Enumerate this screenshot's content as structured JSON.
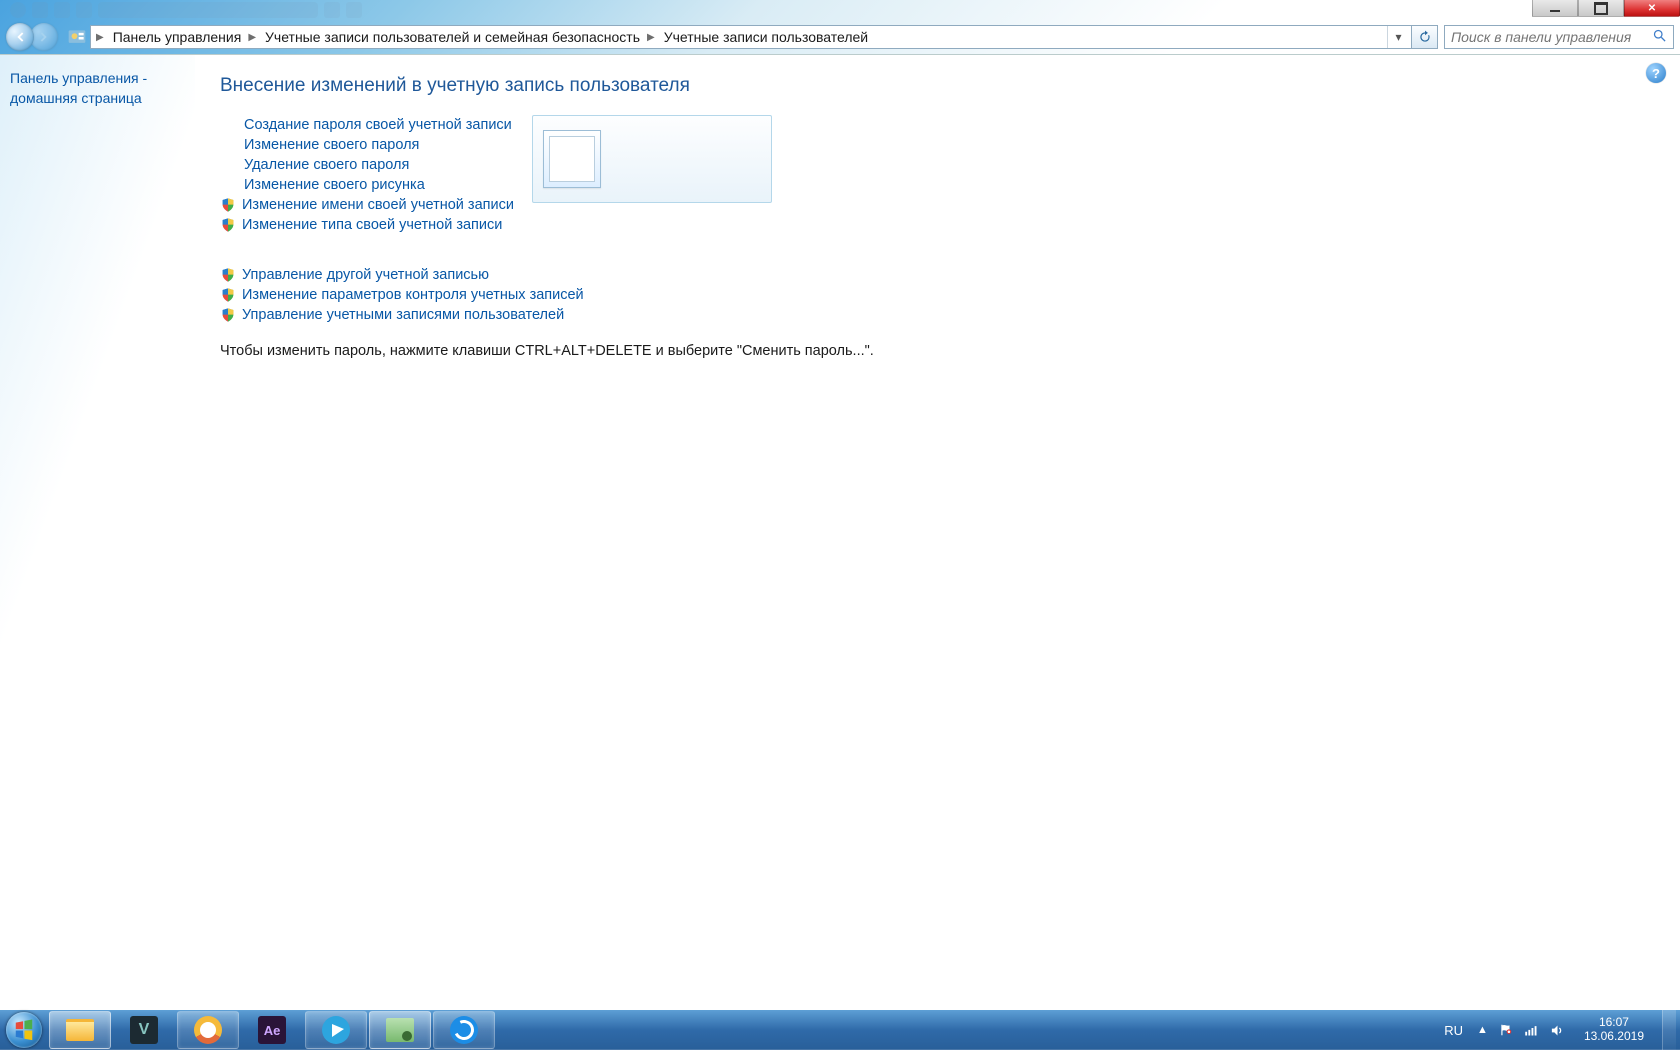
{
  "breadcrumb": {
    "root": "Панель управления",
    "level1": "Учетные записи пользователей и семейная безопасность",
    "level2": "Учетные записи пользователей"
  },
  "search": {
    "placeholder": "Поиск в панели управления"
  },
  "left": {
    "home_line1": "Панель управления -",
    "home_line2": "домашняя страница"
  },
  "main": {
    "heading": "Внесение изменений в учетную запись пользователя",
    "tasks1": [
      "Создание пароля своей учетной записи",
      "Изменение своего пароля",
      "Удаление своего пароля",
      "Изменение своего рисунка",
      "Изменение имени своей учетной записи",
      "Изменение типа своей учетной записи"
    ],
    "tasks1_shield_from_index": 4,
    "tasks2": [
      "Управление другой учетной записью",
      "Изменение параметров контроля учетных записей",
      "Управление учетными записями пользователей"
    ],
    "hint": "Чтобы изменить пароль, нажмите клавиши CTRL+ALT+DELETE и выберите \"Сменить пароль...\"."
  },
  "tray": {
    "lang": "RU",
    "time": "16:07",
    "date": "13.06.2019"
  }
}
